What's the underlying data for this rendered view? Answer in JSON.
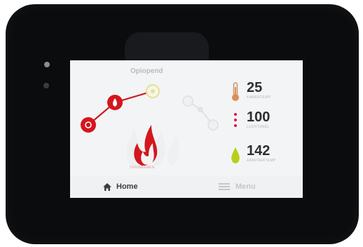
{
  "screen": {
    "title": "Opiopend",
    "mode_label": "VERWARMEN"
  },
  "metrics": [
    {
      "value": "25",
      "label": "KAMERTEMP",
      "icon": "thermometer-icon",
      "color": "#d98f5a"
    },
    {
      "value": "100",
      "label": "LUCHTSNEL",
      "icon": "dots-icon",
      "color": "#d4164b"
    },
    {
      "value": "142",
      "label": "AANVOERTEMP",
      "icon": "drop-icon",
      "color": "#b9cf1a"
    }
  ],
  "nav": {
    "home_label": "Home",
    "menu_label": "Menu"
  },
  "colors": {
    "accent_red": "#d4161e",
    "accent_yellow": "#e9e59b",
    "text_dark": "#2b2e33",
    "screen_bg": "#f3f4f5"
  }
}
